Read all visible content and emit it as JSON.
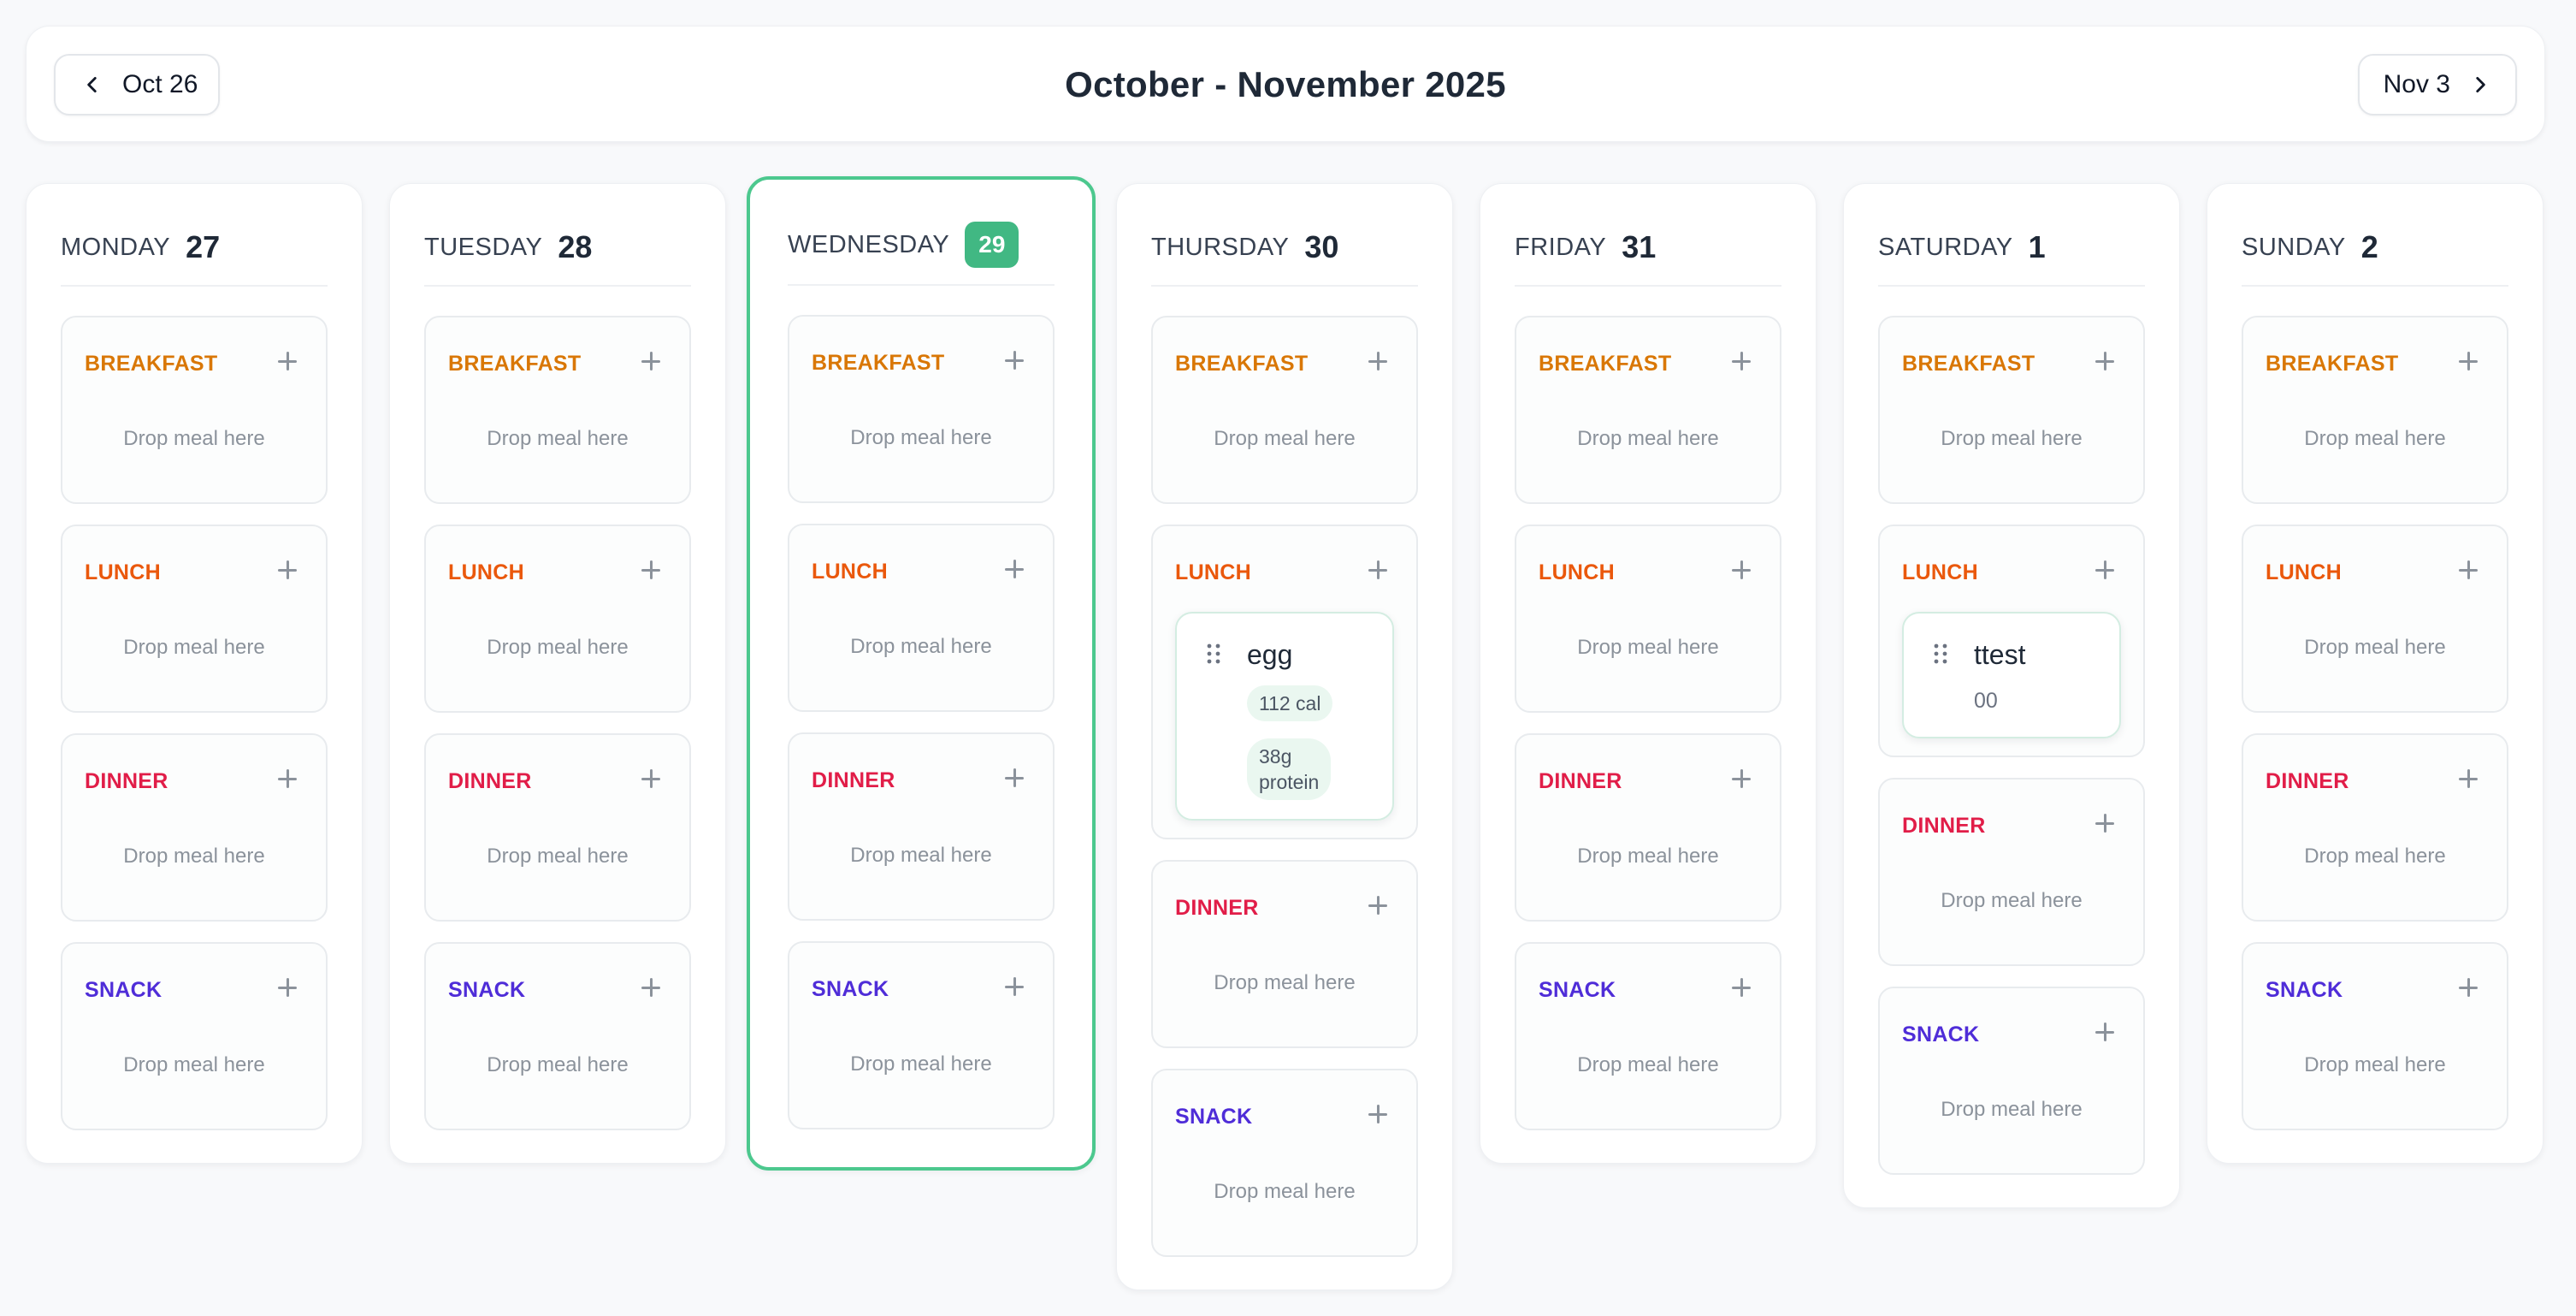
{
  "header": {
    "prev_label": "Oct 26",
    "title": "October - November 2025",
    "next_label": "Nov 3"
  },
  "colors": {
    "today_accent": "#41b883",
    "breakfast": "#d97706",
    "lunch": "#ea580c",
    "dinner": "#e11d48",
    "snack": "#4f2dd8"
  },
  "slot_labels": {
    "breakfast": "BREAKFAST",
    "lunch": "LUNCH",
    "dinner": "DINNER",
    "snack": "SNACK"
  },
  "drop_placeholder": "Drop meal here",
  "days": [
    {
      "name": "MONDAY",
      "num": "27"
    },
    {
      "name": "TUESDAY",
      "num": "28"
    },
    {
      "name": "WEDNESDAY",
      "num": "29",
      "today": true
    },
    {
      "name": "THURSDAY",
      "num": "30"
    },
    {
      "name": "FRIDAY",
      "num": "31"
    },
    {
      "name": "SATURDAY",
      "num": "1"
    },
    {
      "name": "SUNDAY",
      "num": "2"
    }
  ],
  "meals": {
    "thursday_lunch": {
      "name": "egg",
      "calories": "112 cal",
      "protein_line1": "38g",
      "protein_line2": "protein"
    },
    "saturday_lunch": {
      "name": "ttest",
      "detail": "00"
    }
  }
}
